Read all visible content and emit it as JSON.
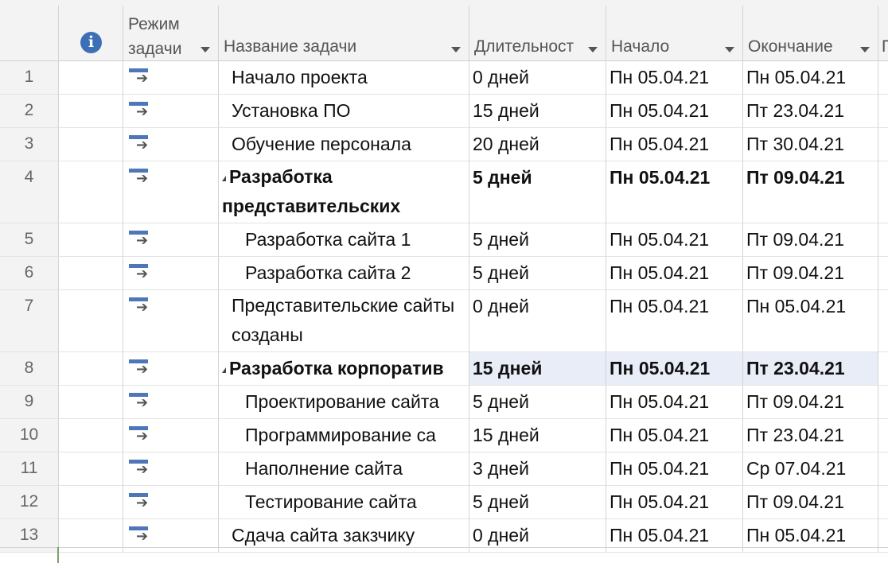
{
  "headers": {
    "mode": "Режим задачи",
    "name": "Название задачи",
    "duration": "Длительност",
    "start": "Начало",
    "finish": "Окончание",
    "next": "П"
  },
  "info_icon": "info-icon",
  "colors": {
    "accent": "#3c6fb5",
    "highlight": "#e9edf8"
  },
  "rows": [
    {
      "num": "1",
      "name": "Начало проекта",
      "duration": "0 дней",
      "start": "Пн 05.04.21",
      "finish": "Пн 05.04.21"
    },
    {
      "num": "2",
      "name": "Установка ПО",
      "duration": "15 дней",
      "start": "Пн 05.04.21",
      "finish": "Пт 23.04.21"
    },
    {
      "num": "3",
      "name": "Обучение персонала",
      "duration": "20 дней",
      "start": "Пн 05.04.21",
      "finish": "Пт 30.04.21"
    },
    {
      "num": "4",
      "name": "Разработка представительских",
      "duration": "5 дней",
      "start": "Пн 05.04.21",
      "finish": "Пт 09.04.21"
    },
    {
      "num": "5",
      "name": "Разработка сайта 1",
      "duration": "5 дней",
      "start": "Пн 05.04.21",
      "finish": "Пт 09.04.21"
    },
    {
      "num": "6",
      "name": "Разработка сайта 2",
      "duration": "5 дней",
      "start": "Пн 05.04.21",
      "finish": "Пт 09.04.21"
    },
    {
      "num": "7",
      "name": "Представительские сайты созданы",
      "duration": "0 дней",
      "start": "Пн 05.04.21",
      "finish": "Пн 05.04.21"
    },
    {
      "num": "8",
      "name": "Разработка корпоратив",
      "duration": "15 дней",
      "start": "Пн 05.04.21",
      "finish": "Пт 23.04.21"
    },
    {
      "num": "9",
      "name": "Проектирование сайта",
      "duration": "5 дней",
      "start": "Пн 05.04.21",
      "finish": "Пт 09.04.21"
    },
    {
      "num": "10",
      "name": "Программирование са",
      "duration": "15 дней",
      "start": "Пн 05.04.21",
      "finish": "Пт 23.04.21"
    },
    {
      "num": "11",
      "name": "Наполнение сайта",
      "duration": "3 дней",
      "start": "Пн 05.04.21",
      "finish": "Ср 07.04.21"
    },
    {
      "num": "12",
      "name": "Тестирование сайта",
      "duration": "5 дней",
      "start": "Пн 05.04.21",
      "finish": "Пт 09.04.21"
    },
    {
      "num": "13",
      "name": "Сдача сайта закзчику",
      "duration": "0 дней",
      "start": "Пн 05.04.21",
      "finish": "Пн 05.04.21"
    }
  ]
}
